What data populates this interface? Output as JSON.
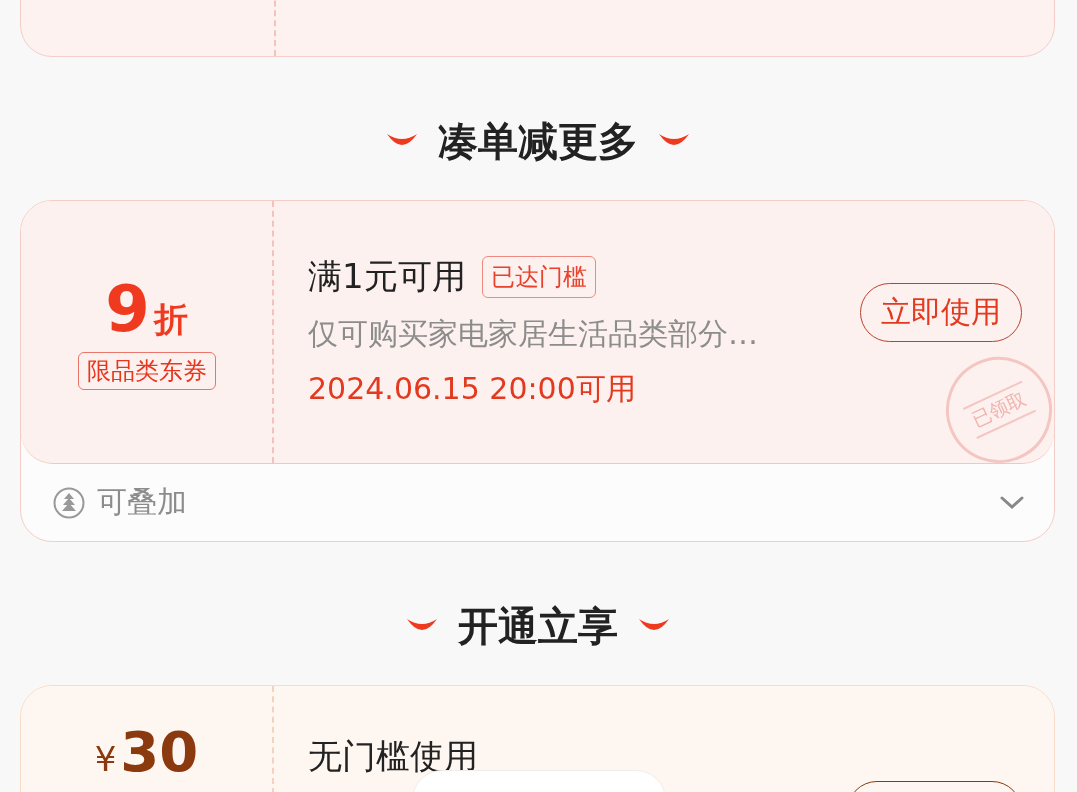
{
  "sections": [
    {
      "title": "凑单减更多",
      "coupons": [
        {
          "kind": "red",
          "value": "9",
          "unit": "折",
          "category_tag": "限品类东券",
          "condition": "满1元可用",
          "status_tag": "已达门槛",
          "description": "仅可购买家电家居生活品类部分…",
          "valid_time": "2024.06.15 20:00可用",
          "action": "立即使用",
          "stamp": "已领取",
          "stackable": "可叠加",
          "expandable": true
        }
      ]
    },
    {
      "title": "开通立享",
      "coupons": [
        {
          "kind": "gold",
          "currency": "¥",
          "value": "30",
          "condition": "无门槛使用"
        }
      ]
    }
  ]
}
